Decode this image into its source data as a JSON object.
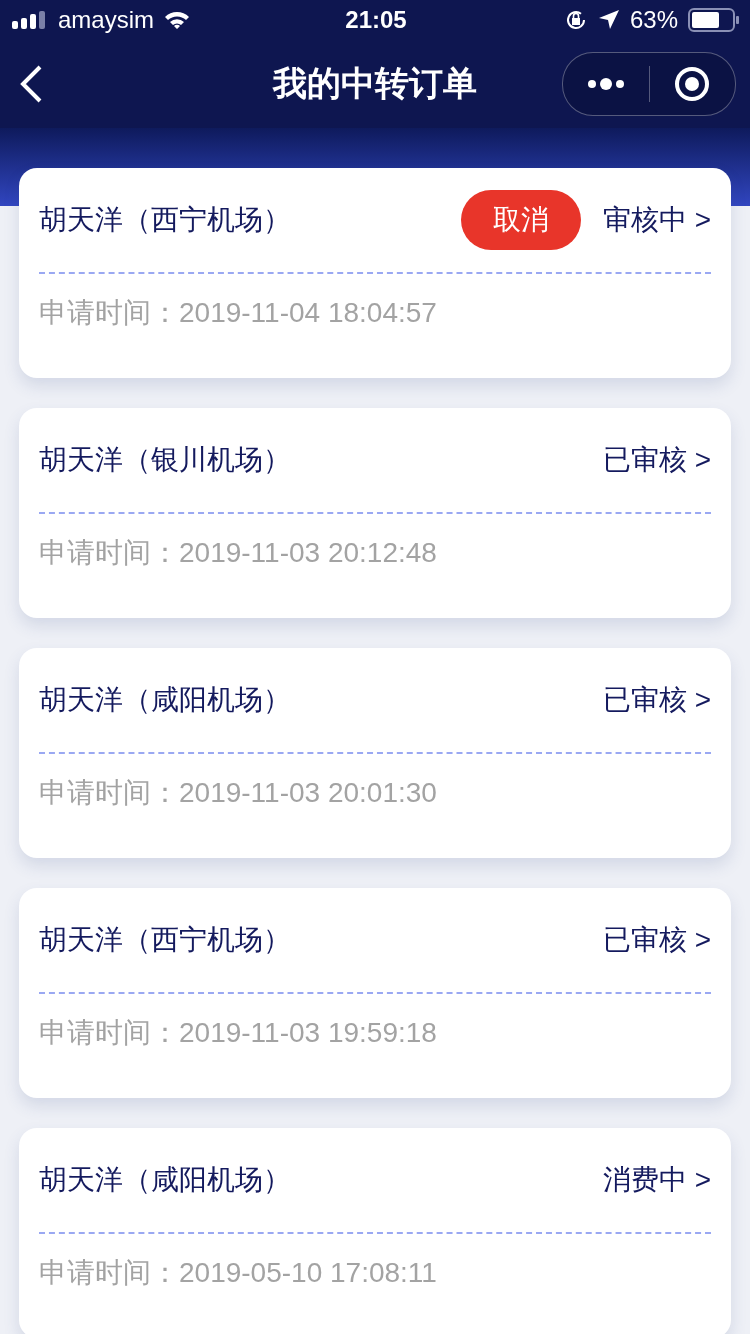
{
  "status_bar": {
    "carrier": "amaysim",
    "time": "21:05",
    "battery": "63%"
  },
  "nav": {
    "title": "我的中转订单"
  },
  "orders": [
    {
      "name": "胡天洋（西宁机场）",
      "status": "审核中 >",
      "cancel": "取消",
      "time": "申请时间：2019-11-04 18:04:57"
    },
    {
      "name": "胡天洋（银川机场）",
      "status": "已审核 >",
      "time": "申请时间：2019-11-03 20:12:48"
    },
    {
      "name": "胡天洋（咸阳机场）",
      "status": "已审核 >",
      "time": "申请时间：2019-11-03 20:01:30"
    },
    {
      "name": "胡天洋（西宁机场）",
      "status": "已审核 >",
      "time": "申请时间：2019-11-03 19:59:18"
    },
    {
      "name": "胡天洋（咸阳机场）",
      "status": "消费中 >",
      "time": "申请时间：2019-05-10 17:08:11"
    }
  ]
}
